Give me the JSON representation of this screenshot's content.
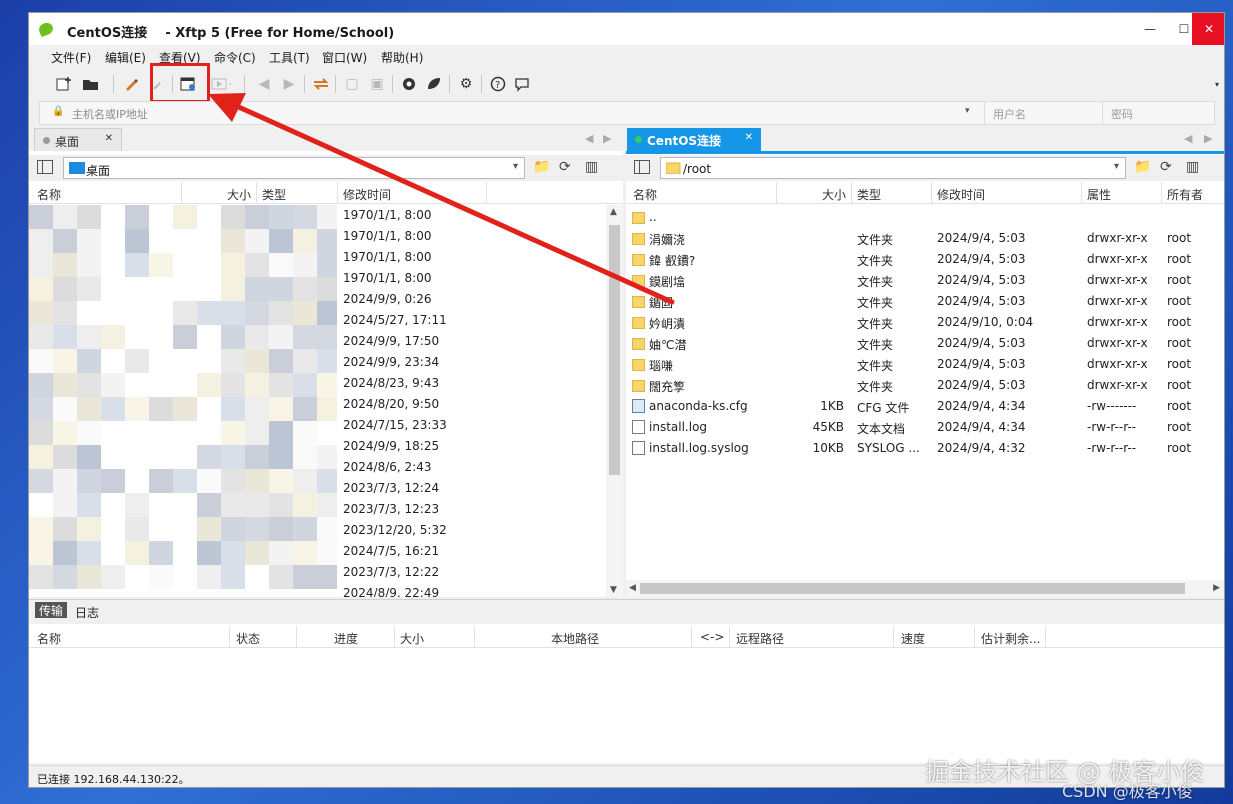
{
  "window": {
    "title": "CentOS连接    - Xftp 5 (Free for Home/School)",
    "minimize": "—",
    "maximize": "☐",
    "close": "✕"
  },
  "menu": [
    "文件(F)",
    "编辑(E)",
    "查看(V)",
    "命令(C)",
    "工具(T)",
    "窗口(W)",
    "帮助(H)"
  ],
  "toolbar": {
    "icons": [
      "new-session-icon",
      "open-folder-icon",
      "properties-brush-icon",
      "disconnect-icon",
      "new-transfer-icon",
      "transfer-play-icon",
      "back-arrow-icon",
      "forward-arrow-icon",
      "sync-icon",
      "copy-icon",
      "paste-icon",
      "xshell-icon",
      "xftp-icon",
      "settings-icon",
      "help-icon",
      "chat-icon"
    ],
    "highlight_color": "#e0221b"
  },
  "address": {
    "host_placeholder": "主机名或IP地址",
    "user_placeholder": "用户名",
    "password_placeholder": "密码"
  },
  "left_pane": {
    "tab": "桌面",
    "path": "桌面",
    "columns": [
      "名称",
      "大小",
      "类型",
      "修改时间"
    ],
    "dates": [
      "1970/1/1, 8:00",
      "1970/1/1, 8:00",
      "1970/1/1, 8:00",
      "1970/1/1, 8:00",
      "2024/9/9, 0:26",
      "2024/5/27, 17:11",
      "2024/9/9, 17:50",
      "2024/9/9, 23:34",
      "2024/8/23, 9:43",
      "2024/8/20, 9:50",
      "2024/7/15, 23:33",
      "2024/9/9, 18:25",
      "2024/8/6, 2:43",
      "2023/7/3, 12:24",
      "2023/7/3, 12:23",
      "2023/12/20, 5:32",
      "2024/7/5, 16:21",
      "2023/7/3, 12:22",
      "2024/8/9, 22:49"
    ]
  },
  "right_pane": {
    "tab": "CentOS连接",
    "path": "/root",
    "accent": "#1696e6",
    "columns": [
      "名称",
      "大小",
      "类型",
      "修改时间",
      "属性",
      "所有者"
    ],
    "rows": [
      {
        "icon": "folder",
        "name": "..",
        "size": "",
        "type": "",
        "date": "",
        "attr": "",
        "owner": ""
      },
      {
        "icon": "folder",
        "name": "涓嬭浇",
        "size": "",
        "type": "文件夹",
        "date": "2024/9/4, 5:03",
        "attr": "drwxr-xr-x",
        "owner": "root"
      },
      {
        "icon": "folder",
        "name": "鍏   叡鐨?",
        "size": "",
        "type": "文件夹",
        "date": "2024/9/4, 5:03",
        "attr": "drwxr-xr-x",
        "owner": "root"
      },
      {
        "icon": "folder",
        "name": "鏌剧墖",
        "size": "",
        "type": "文件夹",
        "date": "2024/9/4, 5:03",
        "attr": "drwxr-xr-x",
        "owner": "root"
      },
      {
        "icon": "folder",
        "name": "鍎囩",
        "size": "",
        "type": "文件夹",
        "date": "2024/9/4, 5:03",
        "attr": "drwxr-xr-x",
        "owner": "root"
      },
      {
        "icon": "folder",
        "name": "妗岄潰",
        "size": "",
        "type": "文件夹",
        "date": "2024/9/10, 0:04",
        "attr": "drwxr-xr-x",
        "owner": "root"
      },
      {
        "icon": "folder",
        "name": "妯℃澘",
        "size": "",
        "type": "文件夹",
        "date": "2024/9/4, 5:03",
        "attr": "drwxr-xr-x",
        "owner": "root"
      },
      {
        "icon": "folder",
        "name": "瑙嗛",
        "size": "",
        "type": "文件夹",
        "date": "2024/9/4, 5:03",
        "attr": "drwxr-xr-x",
        "owner": "root"
      },
      {
        "icon": "folder",
        "name": "闊充箰",
        "size": "",
        "type": "文件夹",
        "date": "2024/9/4, 5:03",
        "attr": "drwxr-xr-x",
        "owner": "root"
      },
      {
        "icon": "cfg",
        "name": "anaconda-ks.cfg",
        "size": "1KB",
        "type": "CFG 文件",
        "date": "2024/9/4, 4:34",
        "attr": "-rw-------",
        "owner": "root"
      },
      {
        "icon": "doc",
        "name": "install.log",
        "size": "45KB",
        "type": "文本文档",
        "date": "2024/9/4, 4:34",
        "attr": "-rw-r--r--",
        "owner": "root"
      },
      {
        "icon": "doc",
        "name": "install.log.syslog",
        "size": "10KB",
        "type": "SYSLOG ...",
        "date": "2024/9/4, 4:32",
        "attr": "-rw-r--r--",
        "owner": "root"
      }
    ]
  },
  "transfer": {
    "tabs": [
      "传输",
      "日志"
    ],
    "columns": [
      "名称",
      "状态",
      "进度",
      "大小",
      "本地路径",
      "<->",
      "远程路径",
      "速度",
      "估计剩余..."
    ]
  },
  "status": "已连接 192.168.44.130:22。",
  "watermark": {
    "line1": "掘金技术社区 @ 极客小俊",
    "line2": "CSDN @极客小俊"
  }
}
